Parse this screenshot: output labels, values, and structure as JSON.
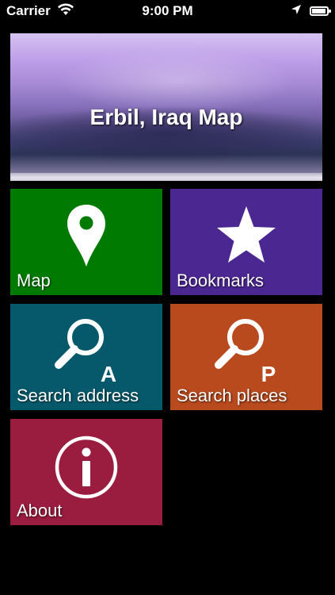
{
  "status_bar": {
    "carrier": "Carrier",
    "time": "9:00 PM",
    "battery_level": 0.95
  },
  "header": {
    "title": "Erbil, Iraq Map"
  },
  "tiles": [
    {
      "id": "map",
      "label": "Map",
      "icon": "map-pin-icon",
      "color": "#007a00"
    },
    {
      "id": "bookmarks",
      "label": "Bookmarks",
      "icon": "star-icon",
      "color": "#4b2792"
    },
    {
      "id": "search_address",
      "label": "Search address",
      "icon": "magnifier-a-icon",
      "icon_letter": "A",
      "color": "#05596a"
    },
    {
      "id": "search_places",
      "label": "Search places",
      "icon": "magnifier-p-icon",
      "icon_letter": "P",
      "color": "#b84a1d"
    },
    {
      "id": "about",
      "label": "About",
      "icon": "info-icon",
      "color": "#9a1c3e"
    }
  ]
}
